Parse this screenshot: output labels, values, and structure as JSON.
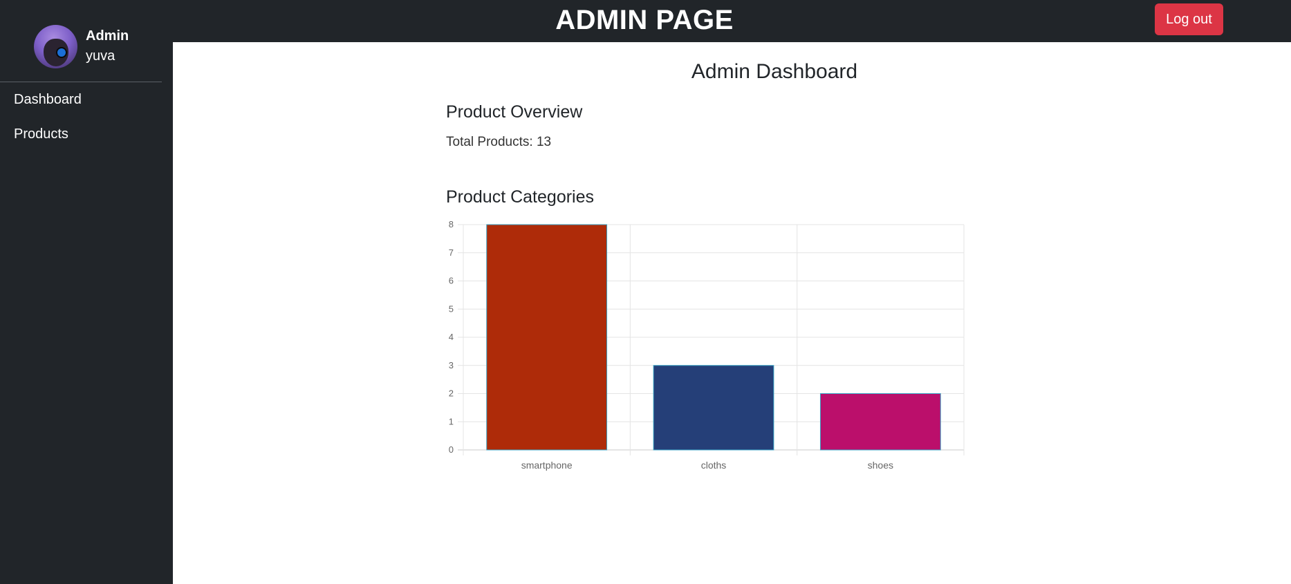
{
  "header": {
    "title": "ADMIN PAGE",
    "logout_label": "Log out"
  },
  "sidebar": {
    "user_role": "Admin",
    "user_name": "yuva",
    "items": [
      {
        "label": "Dashboard"
      },
      {
        "label": "Products"
      }
    ]
  },
  "main": {
    "title": "Admin Dashboard",
    "overview_heading": "Product Overview",
    "total_products_text": "Total Products: 13",
    "categories_heading": "Product Categories"
  },
  "colors": {
    "dark_bg": "#212529",
    "logout_red": "#dc3545"
  },
  "chart_data": {
    "type": "bar",
    "categories": [
      "smartphone",
      "cloths",
      "shoes"
    ],
    "values": [
      8,
      3,
      2
    ],
    "colors": [
      "#ae2b09",
      "#253f78",
      "#bb0f6b"
    ],
    "ylim": [
      0,
      8
    ],
    "yticks": [
      0,
      1,
      2,
      3,
      4,
      5,
      6,
      7,
      8
    ],
    "grid": true,
    "legend": "none"
  }
}
